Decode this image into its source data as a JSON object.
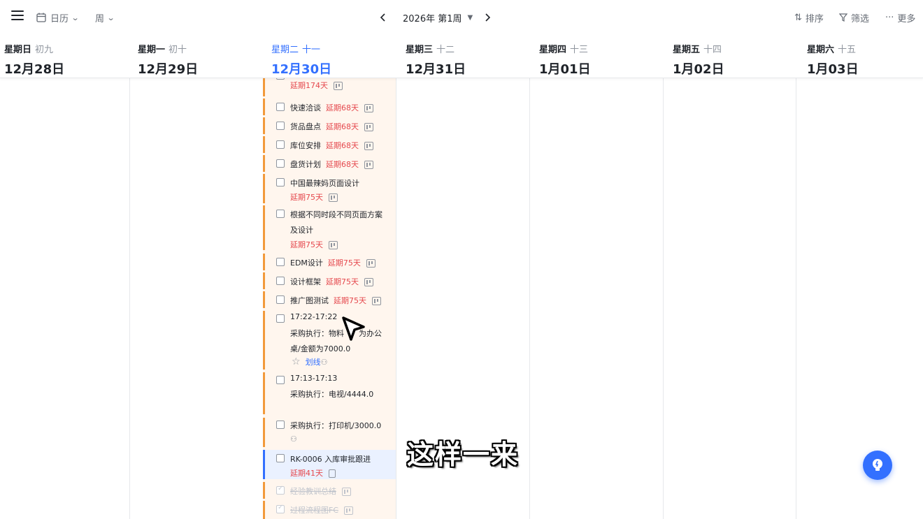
{
  "toolbar": {
    "view_label": "日历",
    "range_label": "周",
    "period_label": "2026年 第1周",
    "sort_label": "排序",
    "filter_label": "筛选",
    "more_label": "更多"
  },
  "days": [
    {
      "weekday": "星期日",
      "lunar": "初九",
      "date": "12月28日",
      "today": false
    },
    {
      "weekday": "星期一",
      "lunar": "初十",
      "date": "12月29日",
      "today": false
    },
    {
      "weekday": "星期二",
      "lunar": "十一",
      "date": "12月30日",
      "today": true
    },
    {
      "weekday": "星期三",
      "lunar": "十二",
      "date": "12月31日",
      "today": false
    },
    {
      "weekday": "星期四",
      "lunar": "十三",
      "date": "1月01日",
      "today": false
    },
    {
      "weekday": "星期五",
      "lunar": "十四",
      "date": "1月02日",
      "today": false
    },
    {
      "weekday": "星期六",
      "lunar": "十五",
      "date": "1月03日",
      "today": false
    }
  ],
  "tasks": [
    {
      "title": "",
      "overdue": "延期174天"
    },
    {
      "title": "快速洽谈",
      "overdue": "延期68天"
    },
    {
      "title": "货品盘点",
      "overdue": "延期68天"
    },
    {
      "title": "库位安排",
      "overdue": "延期68天"
    },
    {
      "title": "盘货计划",
      "overdue": "延期68天"
    },
    {
      "title": "中国最辣妈页面设计",
      "overdue": "延期75天"
    },
    {
      "title_line1": "根据不同时段不同页面方案",
      "title_line2": "及设计",
      "overdue": "延期75天"
    },
    {
      "title": "EDM设计",
      "overdue": "延期75天"
    },
    {
      "title": "设计框架",
      "overdue": "延期75天"
    },
    {
      "title": "推广图测试",
      "overdue": "延期75天"
    },
    {
      "time": "17:22-17:22",
      "line1": "采购执行：物料",
      "line1_tail": "为办公",
      "line2": "桌/金额为7000.0",
      "link": "划线"
    },
    {
      "time": "17:13-17:13",
      "line1": "采购执行：电视/4444.0"
    },
    {
      "line1": "采购执行：打印机/3000.0"
    },
    {
      "title": "RK-0006 入库审批跟进",
      "overdue": "延期41天"
    },
    {
      "title": "经验教训总结"
    },
    {
      "title": "过程流程图FC"
    }
  ],
  "subtitle": "这样一来",
  "colors": {
    "accent": "#3370ff",
    "overdue": "#e5484d",
    "task_bar": "#f29a3b",
    "today_bg": "#fff6ee"
  }
}
